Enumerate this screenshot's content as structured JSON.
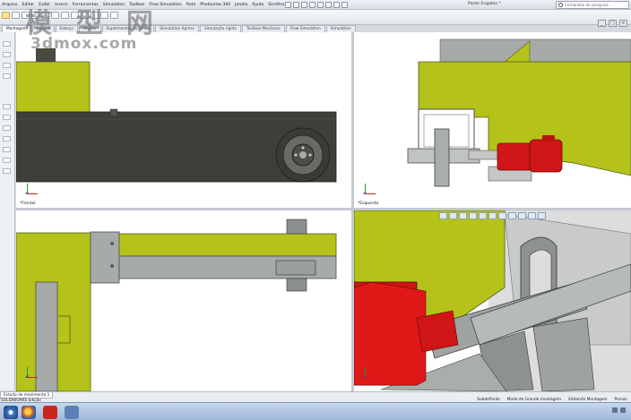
{
  "menu": {
    "items": [
      "Arquivo",
      "Editar",
      "Exibir",
      "Inserir",
      "Ferramentas",
      "Simulation",
      "Toolbox",
      "Flow Simulation",
      "Rota",
      "Photoview 360",
      "Janela",
      "Ajuda",
      "SimXtro3"
    ]
  },
  "document": {
    "title": "Ponte Engates *"
  },
  "search": {
    "placeholder": "Comandos de pesquisa"
  },
  "tabs": [
    "Montagem",
    "Layout",
    "Esboço",
    "Avaliar",
    "Suplementos do Office",
    "Simulation Xpress",
    "Simulação rígida",
    "Toolbox Mecânico",
    "Flow Simulation",
    "Simulation"
  ],
  "watermark": {
    "chinese": "模 型 网",
    "url": "3dmox.com"
  },
  "viewports": {
    "front": {
      "label": "*Frontal"
    },
    "left": {
      "label": "*Esquerda"
    },
    "top": {
      "label": ""
    },
    "iso": {
      "label": ""
    }
  },
  "status": {
    "model_tab": "Estudo de movimento 1",
    "left_text": "SOLIDWORKS Edição",
    "subdefined": "Subdefinido",
    "mode": "Modo de Grande montagem",
    "editing": "Editando Montagem",
    "custom": "Person"
  },
  "colors": {
    "yellow_green": "#b4c21a",
    "dark_beam": "#3f3f3a",
    "steel_gray": "#a6aaa8",
    "motor_red": "#d01616"
  }
}
